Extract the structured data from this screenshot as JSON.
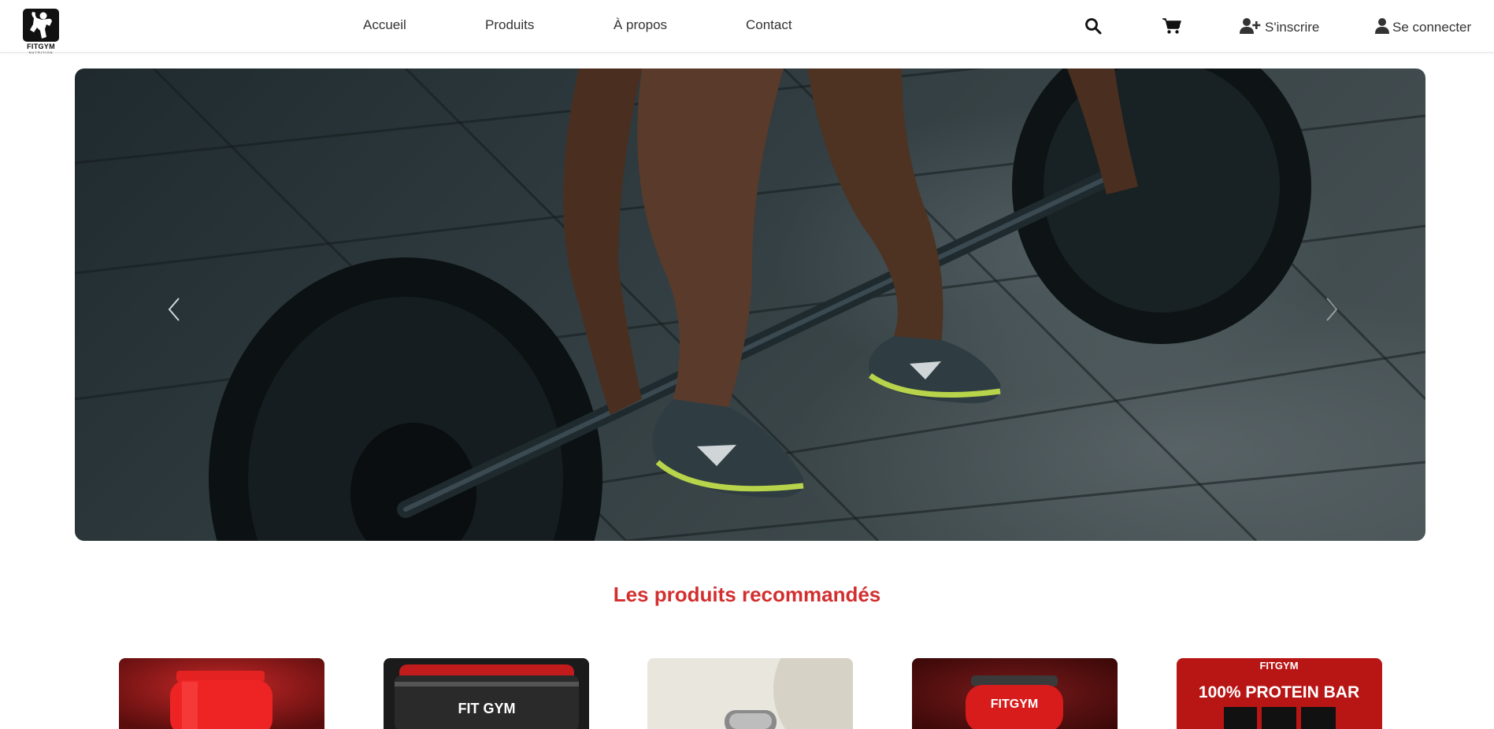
{
  "brand": {
    "name": "FITGYM",
    "tagline": "NUTRITION"
  },
  "nav": {
    "items": [
      {
        "label": "Accueil"
      },
      {
        "label": "Produits"
      },
      {
        "label": "À propos"
      },
      {
        "label": "Contact"
      }
    ]
  },
  "header": {
    "icons": [
      "search-icon",
      "cart-icon"
    ],
    "signup_label": "S'inscrire",
    "login_label": "Se connecter"
  },
  "hero": {
    "image_description": "barbell-deadlift"
  },
  "recommended": {
    "title": "Les produits recommandés",
    "products": [
      {
        "image": "red-protein-tub",
        "label_text": ""
      },
      {
        "image": "black-red-tub",
        "label_text": "FIT GYM"
      },
      {
        "image": "shaker-bottle",
        "label_text": ""
      },
      {
        "image": "red-tub",
        "label_text": "FITGYM"
      },
      {
        "image": "protein-bar",
        "label_text": "100% PROTEIN BAR"
      }
    ]
  },
  "colors": {
    "accent": "#d32f2f",
    "text": "#333333"
  }
}
